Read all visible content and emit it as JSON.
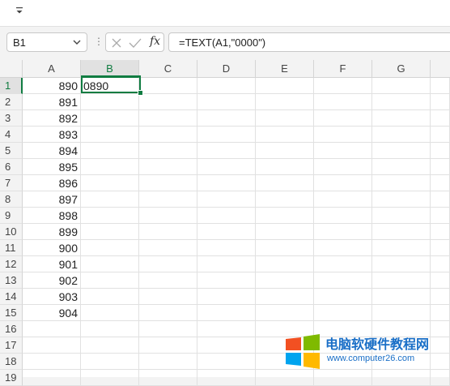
{
  "ribbon": {
    "qat_icon": "customize-qat-icon"
  },
  "formula_bar": {
    "name_box": "B1",
    "cancel_icon": "cancel-x-icon",
    "enter_icon": "enter-check-icon",
    "fx_label": "fx",
    "formula": "=TEXT(A1,\"0000\")",
    "more_icon": "more-dots-icon"
  },
  "sheet": {
    "columns": [
      "A",
      "B",
      "C",
      "D",
      "E",
      "F",
      "G"
    ],
    "selected_column": "B",
    "rows": [
      "1",
      "2",
      "3",
      "4",
      "5",
      "6",
      "7",
      "8",
      "9",
      "10",
      "11",
      "12",
      "13",
      "14",
      "15",
      "16",
      "17",
      "18",
      "19"
    ],
    "selected_row": "1",
    "col_a_values": [
      "890",
      "891",
      "892",
      "893",
      "894",
      "895",
      "896",
      "897",
      "898",
      "899",
      "900",
      "901",
      "902",
      "903",
      "904"
    ],
    "b1_value": "0890",
    "accent_color": "#107c41"
  },
  "watermark": {
    "title": "电脑软硬件教程网",
    "url": "www.computer26.com",
    "logo_colors": [
      "#f25022",
      "#7fba00",
      "#00a4ef",
      "#ffb900"
    ]
  }
}
